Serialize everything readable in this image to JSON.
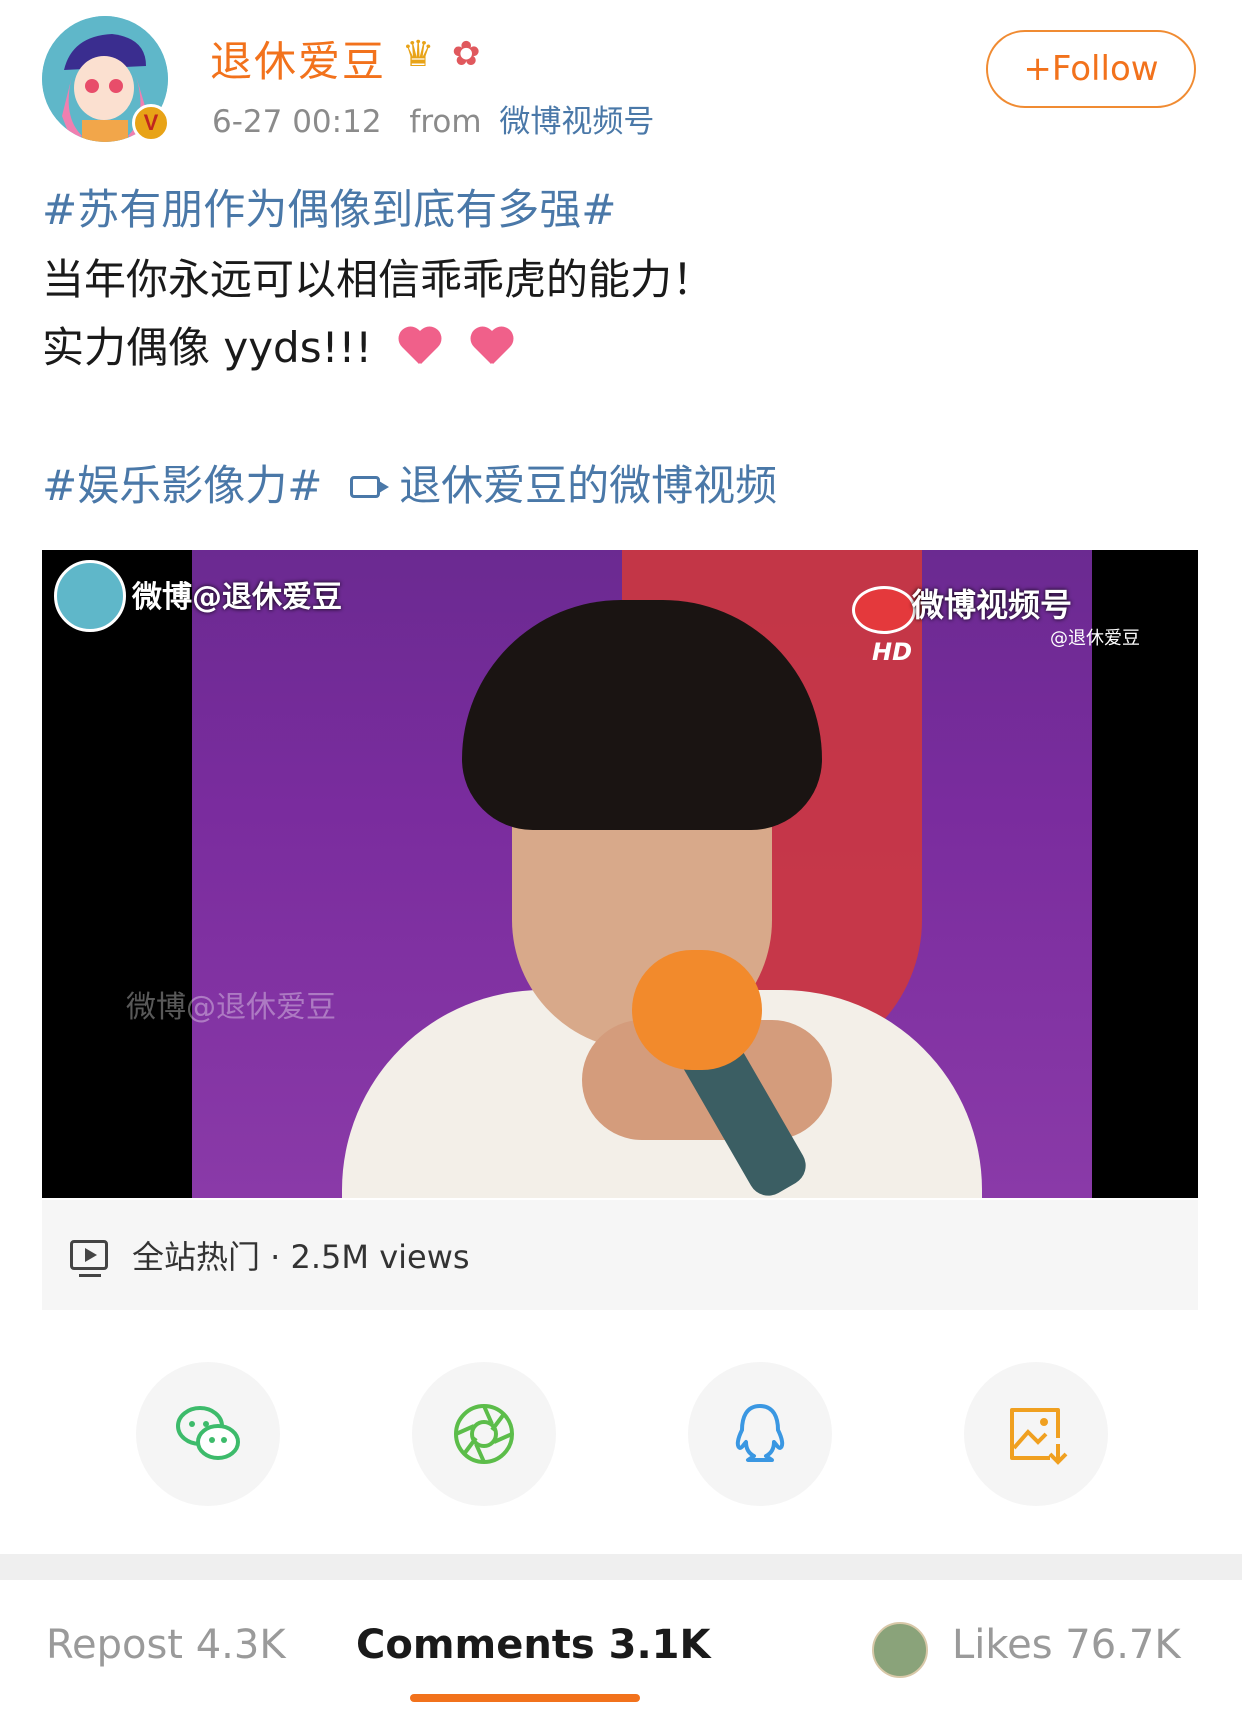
{
  "post": {
    "username": "退休爱豆",
    "timestamp": "6-27 00:12",
    "from_label": "from",
    "source": "微博视频号",
    "follow_label": "+Follow",
    "verified_mark": "V",
    "topic1": "#苏有朋作为偶像到底有多强#",
    "line2": "当年你永远可以相信乖乖虎的能力！",
    "line3": "实力偶像 yyds!!!",
    "topic2": "#娱乐影像力#",
    "video_link": "退休爱豆的微博视频"
  },
  "video": {
    "watermark_left": "微博@退休爱豆",
    "watermark_right": "微博视频号",
    "watermark_handle": "@退休爱豆",
    "watermark_hd": "HD",
    "watermark_ghost": "微博@退休爱豆"
  },
  "views": {
    "text": "全站热门 · 2.5M views"
  },
  "share": [
    {
      "icon": "wechat-icon",
      "color": "#3dbb6b"
    },
    {
      "icon": "moments-icon",
      "color": "#5cbd4a"
    },
    {
      "icon": "qq-icon",
      "color": "#3a97e2"
    },
    {
      "icon": "save-image-icon",
      "color": "#f0a020"
    }
  ],
  "tabs": {
    "repost": "Repost 4.3K",
    "comments": "Comments 3.1K",
    "likes": "Likes 76.7K"
  },
  "colors": {
    "accent": "#f2721c",
    "link": "#4a78a8"
  }
}
